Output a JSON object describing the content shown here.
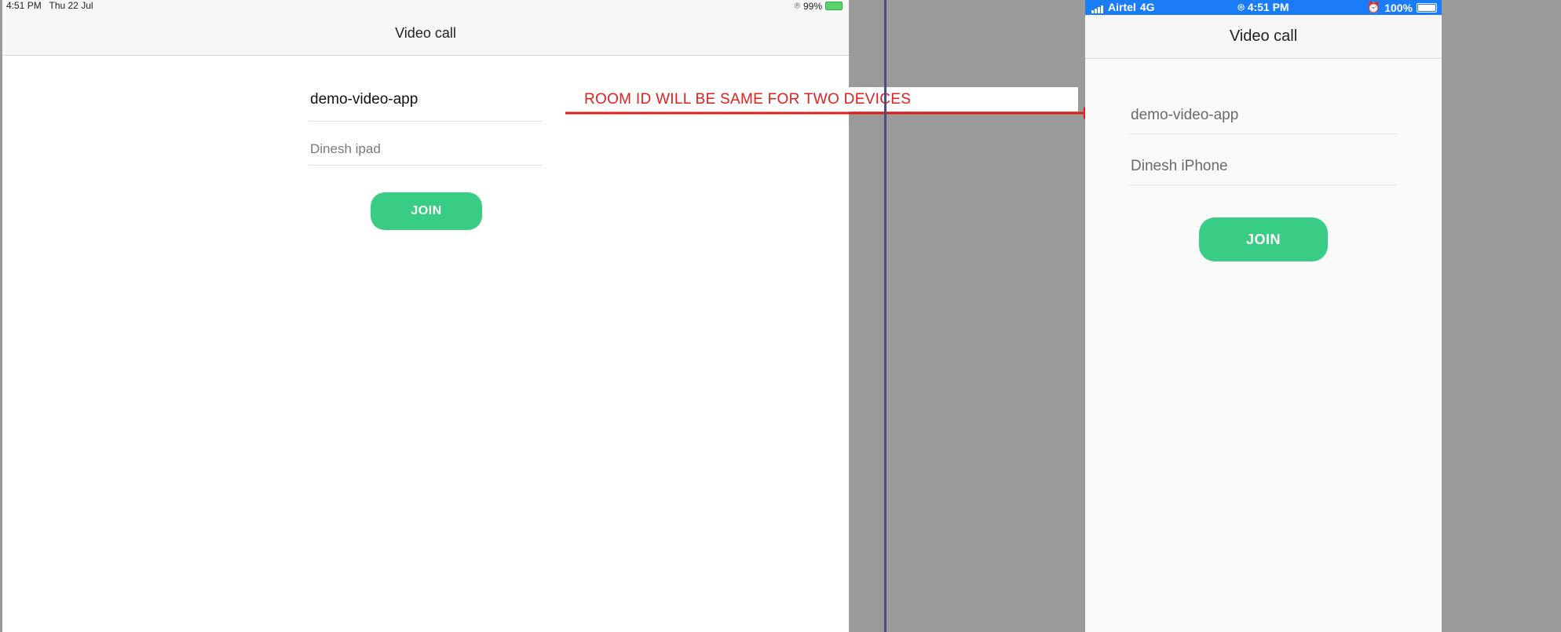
{
  "ipad": {
    "status_time": "4:51 PM",
    "status_date": "Thu 22 Jul",
    "status_battery": "99%",
    "title": "Video call",
    "room_value": "demo-video-app",
    "name_value": "Dinesh ipad",
    "join_label": "JOIN"
  },
  "annotation": {
    "text": "ROOM ID WILL BE SAME FOR TWO DEVICES",
    "color": "#e0201c"
  },
  "iphone": {
    "status_carrier": "Airtel",
    "status_network": "4G",
    "status_time": "4:51 PM",
    "status_battery": "100%",
    "title": "Video call",
    "room_value": "demo-video-app",
    "name_value": "Dinesh iPhone",
    "join_label": "JOIN"
  },
  "colors": {
    "accent_green": "#39cc84",
    "ios_status_blue": "#1a7cf6"
  }
}
